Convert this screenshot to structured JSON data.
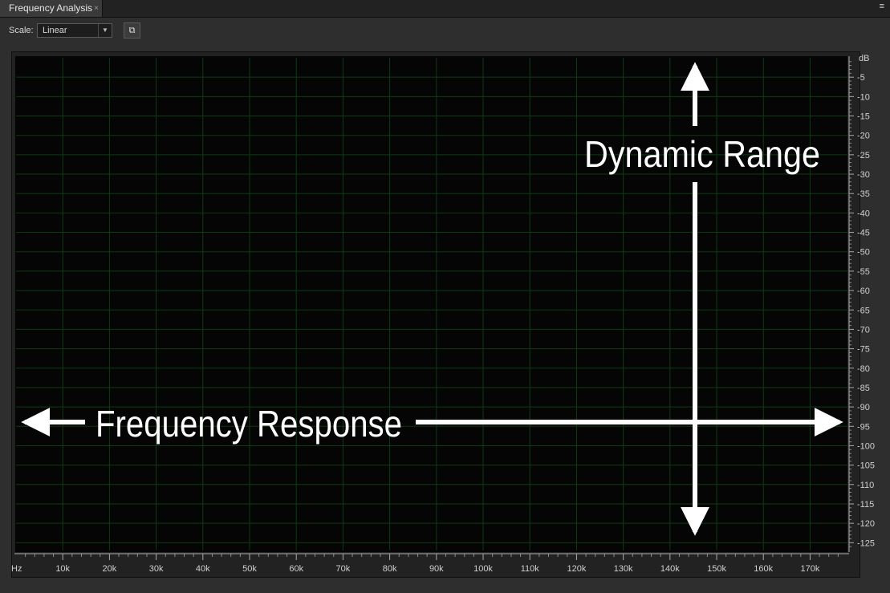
{
  "panel": {
    "tab_title": "Frequency Analysis",
    "close_glyph": "×",
    "menu_glyph": "≡"
  },
  "toolbar": {
    "scale_label": "Scale:",
    "scale_value": "Linear",
    "dropdown_glyph": "▼",
    "copy_glyph": "⧉"
  },
  "chart_data": {
    "type": "line",
    "x_unit": "Hz",
    "x_ticks": [
      "10k",
      "20k",
      "30k",
      "40k",
      "50k",
      "60k",
      "70k",
      "80k",
      "90k",
      "100k",
      "110k",
      "120k",
      "130k",
      "140k",
      "150k",
      "160k",
      "170k"
    ],
    "y_unit": "dB",
    "y_ticks": [
      "-5",
      "-10",
      "-15",
      "-20",
      "-25",
      "-30",
      "-35",
      "-40",
      "-45",
      "-50",
      "-55",
      "-60",
      "-65",
      "-70",
      "-75",
      "-80",
      "-85",
      "-90",
      "-95",
      "-100",
      "-105",
      "-110",
      "-115",
      "-120",
      "-125"
    ],
    "xlim": [
      0,
      178000
    ],
    "ylim": [
      -127,
      0
    ],
    "grid": true,
    "series": []
  },
  "annotations": {
    "horizontal_label": "Frequency Response",
    "vertical_label": "Dynamic Range"
  }
}
